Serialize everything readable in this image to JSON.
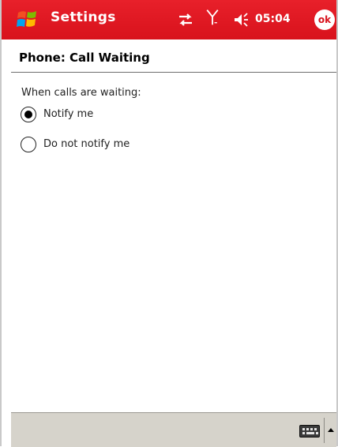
{
  "titlebar": {
    "title": "Settings",
    "time": "05:04",
    "ok_label": "ok",
    "icons": [
      "windows-start-icon",
      "sync-icon",
      "signal-icon",
      "volume-icon"
    ]
  },
  "page": {
    "title": "Phone: Call Waiting",
    "section_label": "When calls are waiting:"
  },
  "options": [
    {
      "label": "Notify me",
      "selected": true
    },
    {
      "label": "Do not notify me",
      "selected": false
    }
  ],
  "bottom_bar": {
    "icons": [
      "keyboard-icon",
      "sip-arrow-up-icon"
    ]
  },
  "colors": {
    "titlebar": "#d8121c",
    "bottom_bar": "#d6d3cb"
  }
}
